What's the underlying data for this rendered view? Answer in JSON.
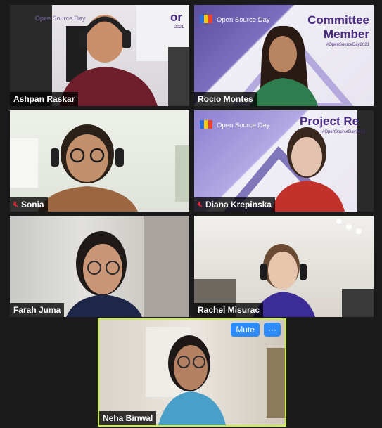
{
  "participants": [
    {
      "name": "Ashpan Raskar",
      "muted": false
    },
    {
      "name": "Rocio Montes",
      "muted": false
    },
    {
      "name": "Sonia",
      "muted": true
    },
    {
      "name": "Diana Krepinska",
      "muted": true
    },
    {
      "name": "Farah Juma",
      "muted": false
    },
    {
      "name": "Rachel Misurac",
      "muted": false
    },
    {
      "name": "Neha Binwal",
      "muted": false
    }
  ],
  "backgrounds": {
    "brand": "Open Source Day",
    "committee_line1": "Committee",
    "committee_line2": "Member",
    "hashtag": "#OpenSourceDay2021",
    "partial_sign": "or",
    "partial_year": "2021",
    "project_text": "Project Re"
  },
  "controls": {
    "mute_label": "Mute",
    "more_label": "···"
  },
  "colors": {
    "background": "#1a1a1a",
    "active_speaker_border": "#c8f03c",
    "button_blue": "#2d8cff",
    "muted_mic_red": "#e0293a"
  }
}
